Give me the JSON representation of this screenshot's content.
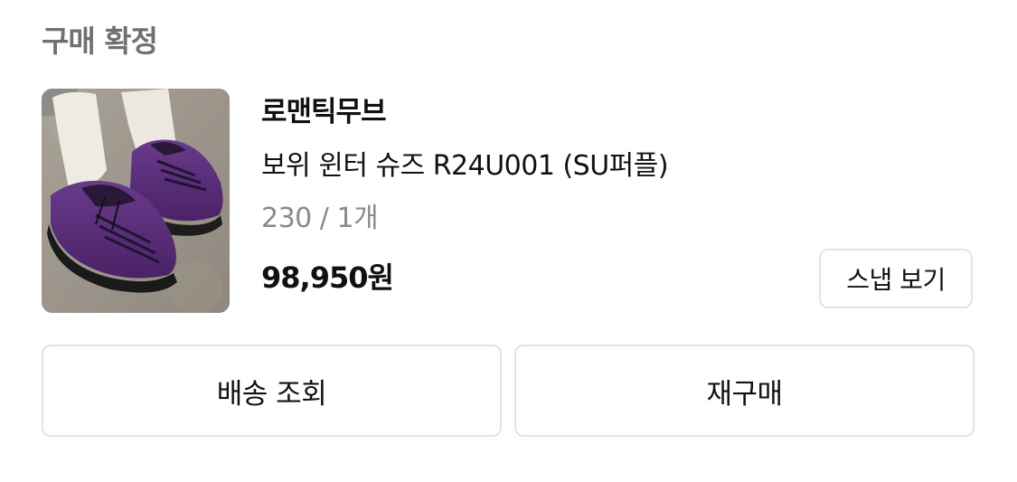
{
  "order": {
    "status_title": "구매 확정"
  },
  "product": {
    "image_icon": "shoe-photo",
    "brand": "로맨틱무브",
    "name": "보위 윈터 슈즈 R24U001 (SU퍼플)",
    "option": "230 / 1개",
    "price": "98,950원"
  },
  "buttons": {
    "snap": "스냅 보기",
    "delivery": "배송 조회",
    "rebuy": "재구매"
  },
  "colors": {
    "status_text": "#707070",
    "option_text": "#8a8a8a",
    "border": "#e4e4e4",
    "shoe_purple": "#5b2d7a"
  }
}
